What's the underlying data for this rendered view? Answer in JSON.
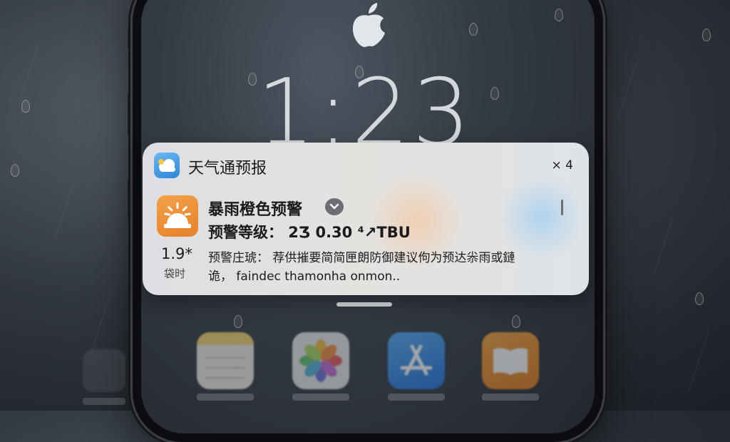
{
  "lock_screen": {
    "time": "1:23"
  },
  "notification": {
    "app_name": "天气通预报",
    "count": "× 4",
    "alert_title": "暴雨橙色预警",
    "level_line": "预警等级： 2Ʒ 0.30 ⁴↗TBU",
    "temperature": "1.9*",
    "temperature_label": "袋时",
    "description_line1": "预警庄琥：  荐供摧要简简匣朗防御建议佝为预达尜雨或鏈",
    "description_line2": "诡，  faindec thamonha onmon.."
  },
  "dock": {
    "apps": [
      "notes-icon",
      "photos-icon",
      "app-store-icon",
      "books-icon"
    ]
  },
  "colors": {
    "notification_bg": "#e0e0e2",
    "app_icon": "#3a8fde",
    "alert_icon": "#ea8a30"
  }
}
